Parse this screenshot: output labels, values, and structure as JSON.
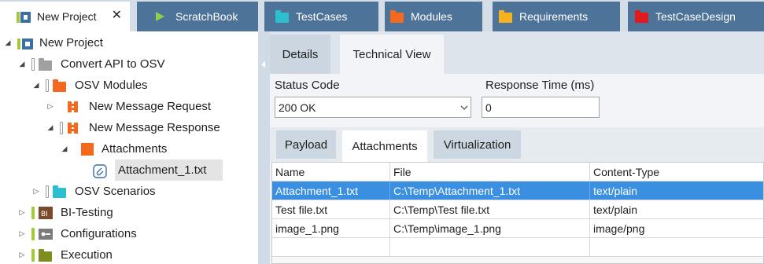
{
  "tabs": [
    {
      "label": "New Project",
      "icon": "project-icon",
      "close": "✕"
    },
    {
      "label": "ScratchBook",
      "icon": "play-icon"
    },
    {
      "label": "TestCases",
      "icon": "folder-cyan-icon",
      "color": "#2bbfd0"
    },
    {
      "label": "Modules",
      "icon": "folder-orange-icon",
      "color": "#f2691f"
    },
    {
      "label": "Requirements",
      "icon": "folder-yellow-icon",
      "color": "#f5b21e"
    },
    {
      "label": "TestCaseDesign",
      "icon": "folder-red-icon",
      "color": "#e01b1b"
    }
  ],
  "tree": [
    {
      "label": "New Project",
      "icon": "project-icon",
      "expander": "◢"
    },
    {
      "label": "Convert API to OSV",
      "icon": "folder-gray-icon",
      "expander": "◢"
    },
    {
      "label": "OSV Modules",
      "icon": "folder-orange-icon",
      "expander": "◢"
    },
    {
      "label": "New Message Request",
      "icon": "module-icon",
      "expander": "▷"
    },
    {
      "label": "New Message Response",
      "icon": "module-icon",
      "expander": "◢"
    },
    {
      "label": "Attachments",
      "icon": "folder-orange-icon",
      "expander": "◢"
    },
    {
      "label": "Attachment_1.txt",
      "icon": "paperclip-icon",
      "expander": ""
    },
    {
      "label": "OSV Scenarios",
      "icon": "folder-cyan-icon",
      "expander": "▷"
    },
    {
      "label": "BI-Testing",
      "icon": "bi-icon",
      "expander": "▷"
    },
    {
      "label": "Configurations",
      "icon": "config-icon",
      "expander": "▷"
    },
    {
      "label": "Execution",
      "icon": "folder-olive-icon",
      "expander": "▷"
    }
  ],
  "view_tabs": {
    "details": "Details",
    "technical": "Technical View"
  },
  "status_code": {
    "label": "Status Code",
    "value": "200 OK"
  },
  "response_time": {
    "label": "Response Time (ms)",
    "value": "0"
  },
  "inner_tabs": {
    "payload": "Payload",
    "attachments": "Attachments",
    "virtualization": "Virtualization"
  },
  "grid": {
    "columns": [
      "Name",
      "File",
      "Content-Type"
    ],
    "rows": [
      [
        "Attachment_1.txt",
        "C:\\Temp\\Attachment_1.txt",
        "text/plain"
      ],
      [
        "Test file.txt",
        "C:\\Temp\\Test file.txt",
        "text/plain"
      ],
      [
        "image_1.png",
        "C:\\Temp\\image_1.png",
        "image/png"
      ]
    ]
  },
  "colors": {
    "accent": "#3b8fe0",
    "tab_inactive": "#4e7398",
    "marker_green": "#a2c83c"
  }
}
